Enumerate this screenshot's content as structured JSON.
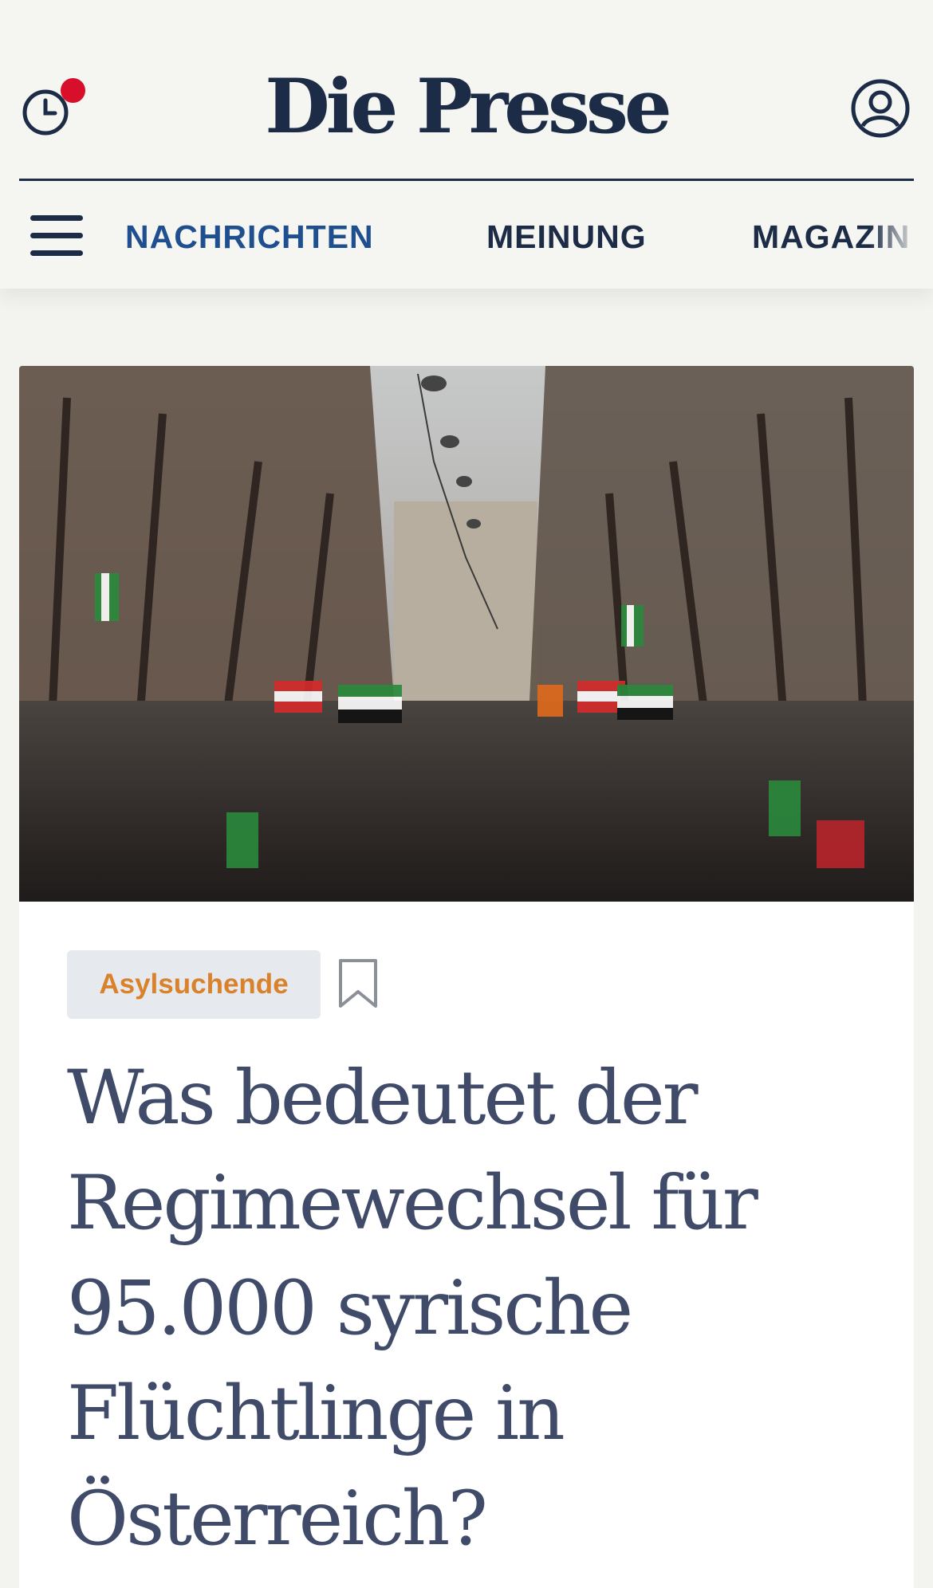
{
  "header": {
    "logo": "Die Presse",
    "history_icon": "clock-icon",
    "notification_dot": true,
    "account_icon": "user-circle-icon"
  },
  "nav": {
    "menu_icon": "hamburger-icon",
    "items": [
      {
        "label": "NACHRICHTEN",
        "active": true
      },
      {
        "label": "MEINUNG",
        "active": false
      },
      {
        "label": "MAGAZIN",
        "active": false
      }
    ]
  },
  "article": {
    "image_description": "",
    "tag": "Asylsuchende",
    "bookmark_icon": "bookmark-icon",
    "headline": "Was bedeutet der Regimewechsel für 95.000 syrische Flüchtlinge in Österreich?"
  },
  "colors": {
    "brand_navy": "#1c2b46",
    "nav_active": "#1f4f8f",
    "tag_text": "#d9822b",
    "headline": "#3f4b69",
    "notification": "#d70f2a"
  }
}
